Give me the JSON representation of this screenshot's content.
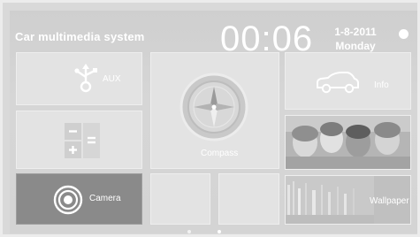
{
  "header": {
    "title": "Car multimedia system",
    "time": "00:06",
    "date": "1-8-2011",
    "weekday": "Monday"
  },
  "tiles": {
    "aux": {
      "label": "AUX",
      "icon": "usb-icon"
    },
    "calculator": {
      "icon": "calculator-icon"
    },
    "camera": {
      "label": "Camera",
      "icon": "camera-lens-icon"
    },
    "compass": {
      "label": "Compass",
      "icon": "compass-icon"
    },
    "info": {
      "label": "Info",
      "icon": "car-icon"
    },
    "photos": {
      "icon": "photo-gallery-icon"
    },
    "wallpaper": {
      "label": "Wallpaper",
      "icon": "wallpaper-icon"
    }
  },
  "pager": {
    "pages": 2,
    "current": 2
  },
  "colors": {
    "background": "#d4d4d4",
    "tile": "#e3e3e3",
    "selected_tile": "#8a8a8a",
    "text": "#ffffff"
  }
}
